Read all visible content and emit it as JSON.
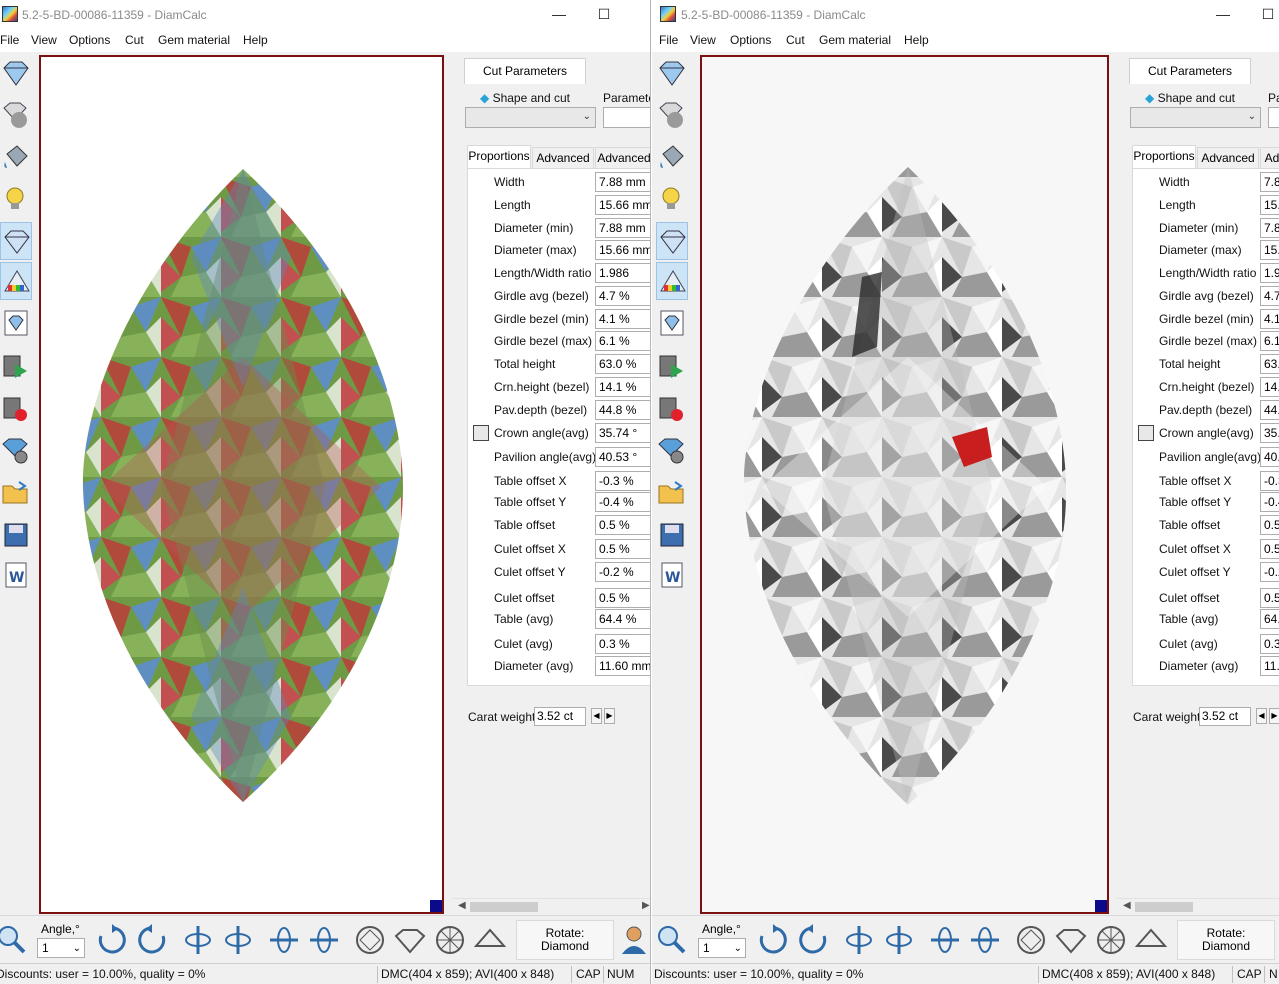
{
  "windows": [
    {
      "title": "5.2-5-BD-00086-11359 - DiamCalc",
      "menu": [
        "File",
        "View",
        "Options",
        "Cut",
        "Gem material",
        "Help"
      ],
      "cut_parameters_tab": "Cut Parameters",
      "shape_and_cut_label": "Shape and cut",
      "parameters_label": "Parameters",
      "subtabs": [
        "Proportions",
        "Advanced",
        "Advanced"
      ],
      "properties": [
        {
          "name": "Width",
          "value": "7.88 mm"
        },
        {
          "name": "Length",
          "value": "15.66 mm"
        },
        {
          "name": "Diameter (min)",
          "value": "7.88 mm"
        },
        {
          "name": "Diameter (max)",
          "value": "15.66 mm"
        },
        {
          "name": "Length/Width ratio",
          "value": "1.986"
        },
        {
          "name": "Girdle avg (bezel)",
          "value": "4.7 %"
        },
        {
          "name": "Girdle bezel (min)",
          "value": "4.1 %"
        },
        {
          "name": "Girdle bezel (max)",
          "value": "6.1 %"
        },
        {
          "name": "Total height",
          "value": "63.0 %"
        },
        {
          "name": "Crn.height (bezel)",
          "value": "14.1 %"
        },
        {
          "name": "Pav.depth (bezel)",
          "value": "44.8 %"
        },
        {
          "name": "Crown angle(avg)",
          "value": "35.74 °"
        },
        {
          "name": "Pavilion angle(avg)",
          "value": "40.53 °"
        },
        {
          "name": "Table offset X",
          "value": "-0.3 %"
        },
        {
          "name": "Table offset Y",
          "value": "-0.4 %"
        },
        {
          "name": "Table offset",
          "value": "0.5 %"
        },
        {
          "name": "Culet offset X",
          "value": "0.5 %"
        },
        {
          "name": "Culet offset Y",
          "value": "-0.2 %"
        },
        {
          "name": "Culet offset",
          "value": "0.5 %"
        },
        {
          "name": "Table (avg)",
          "value": "64.4 %"
        },
        {
          "name": "Culet (avg)",
          "value": "0.3 %"
        },
        {
          "name": "Diameter (avg)",
          "value": "11.60 mm"
        }
      ],
      "carat_label": "Carat weight",
      "carat_value": "3.52 ct",
      "angle_label": "Angle,°",
      "angle_value": "1",
      "rotate_title": "Rotate:",
      "rotate_value": "Diamond",
      "status_discounts": "Discounts: user = 10.00%, quality = 0%",
      "status_dims": "DMC(404 x 859); AVI(400 x 848)",
      "status_cap": "CAP",
      "status_num": "NUM"
    },
    {
      "title": "5.2-5-BD-00086-11359 - DiamCalc",
      "menu": [
        "File",
        "View",
        "Options",
        "Cut",
        "Gem material",
        "Help"
      ],
      "cut_parameters_tab": "Cut Parameters",
      "shape_and_cut_label": "Shape and cut",
      "parameters_label": "Pa",
      "subtabs": [
        "Proportions",
        "Advanced",
        "Adv"
      ],
      "properties": [
        {
          "name": "Width",
          "value": "7.8"
        },
        {
          "name": "Length",
          "value": "15."
        },
        {
          "name": "Diameter (min)",
          "value": "7.8"
        },
        {
          "name": "Diameter (max)",
          "value": "15."
        },
        {
          "name": "Length/Width ratio",
          "value": "1.9"
        },
        {
          "name": "Girdle avg (bezel)",
          "value": "4.7"
        },
        {
          "name": "Girdle bezel (min)",
          "value": "4.1"
        },
        {
          "name": "Girdle bezel (max)",
          "value": "6.1"
        },
        {
          "name": "Total height",
          "value": "63."
        },
        {
          "name": "Crn.height (bezel)",
          "value": "14."
        },
        {
          "name": "Pav.depth (bezel)",
          "value": "44."
        },
        {
          "name": "Crown angle(avg)",
          "value": "35."
        },
        {
          "name": "Pavilion angle(avg)",
          "value": "40."
        },
        {
          "name": "Table offset X",
          "value": "-0.3"
        },
        {
          "name": "Table offset Y",
          "value": "-0.4"
        },
        {
          "name": "Table offset",
          "value": "0.5"
        },
        {
          "name": "Culet offset X",
          "value": "0.5"
        },
        {
          "name": "Culet offset Y",
          "value": "-0.2"
        },
        {
          "name": "Culet offset",
          "value": "0.5"
        },
        {
          "name": "Table (avg)",
          "value": "64."
        },
        {
          "name": "Culet (avg)",
          "value": "0.3"
        },
        {
          "name": "Diameter (avg)",
          "value": "11."
        }
      ],
      "carat_label": "Carat weight",
      "carat_value": "3.52 ct",
      "angle_label": "Angle,°",
      "angle_value": "1",
      "rotate_title": "Rotate:",
      "rotate_value": "Diamond",
      "status_discounts": "Discounts: user = 10.00%, quality = 0%",
      "status_dims": "DMC(408 x 859); AVI(400 x 848)",
      "status_cap": "CAP",
      "status_num": "N"
    }
  ],
  "colors": {
    "viewport_border": "#7a1010",
    "accent_blue": "#0a0a8a",
    "active_tool": "#cde4f7"
  }
}
